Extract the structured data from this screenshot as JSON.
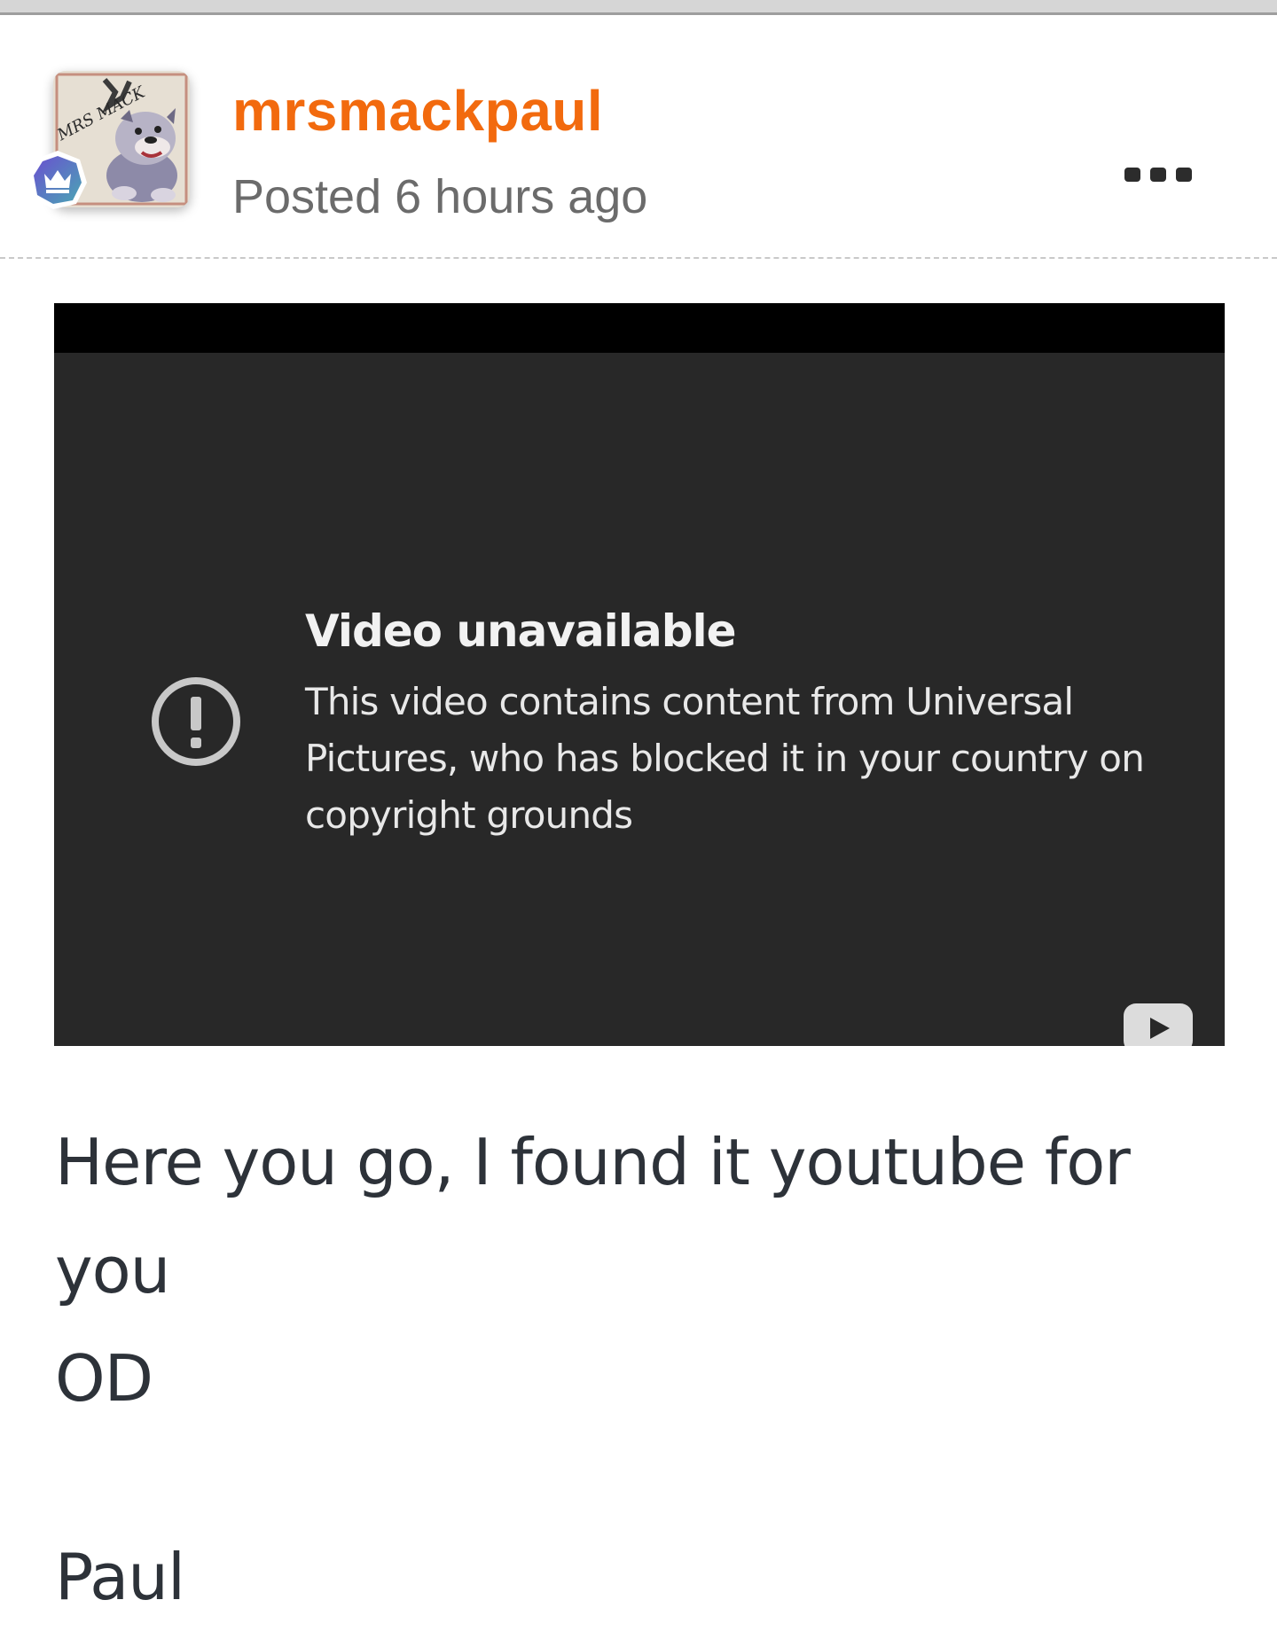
{
  "post": {
    "author": "mrsmackpaul",
    "timestamp": "Posted 6 hours ago",
    "avatar_icon": "bulldog-avatar",
    "avatar_text": "MRS MACK",
    "badge_icon": "crown-icon",
    "menu_icon": "more-options-icon"
  },
  "video": {
    "error_title": "Video unavailable",
    "error_message": "This video contains content from Universal Pictures, who has blocked it in your country on copyright grounds",
    "error_icon": "exclamation-circle-icon",
    "logo_icon": "youtube-play-icon"
  },
  "body": {
    "lines": [
      "Here you go, I found it youtube for you",
      "OD"
    ],
    "signature": "Paul"
  },
  "colors": {
    "username": "#f26a0e",
    "timestamp": "#6b6b6b",
    "video_bg": "#282828",
    "body_text": "#2d3239"
  }
}
